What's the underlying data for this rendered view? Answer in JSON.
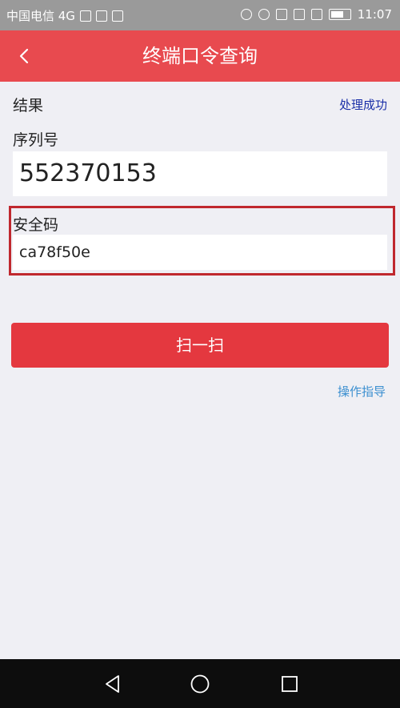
{
  "status_bar": {
    "carrier": "中国电信 4G",
    "time": "11:07"
  },
  "header": {
    "title": "终端口令查询"
  },
  "result": {
    "label": "结果",
    "status": "处理成功"
  },
  "serial": {
    "label": "序列号",
    "value": "552370153"
  },
  "security_code": {
    "label": "安全码",
    "value": "ca78f50e"
  },
  "actions": {
    "scan_label": "扫一扫",
    "guide_label": "操作指导"
  },
  "colors": {
    "header": "#e84a4f",
    "button": "#e4383f",
    "highlight": "#c0282e",
    "status_text": "#1a2fa8",
    "link": "#3b8fd0"
  }
}
